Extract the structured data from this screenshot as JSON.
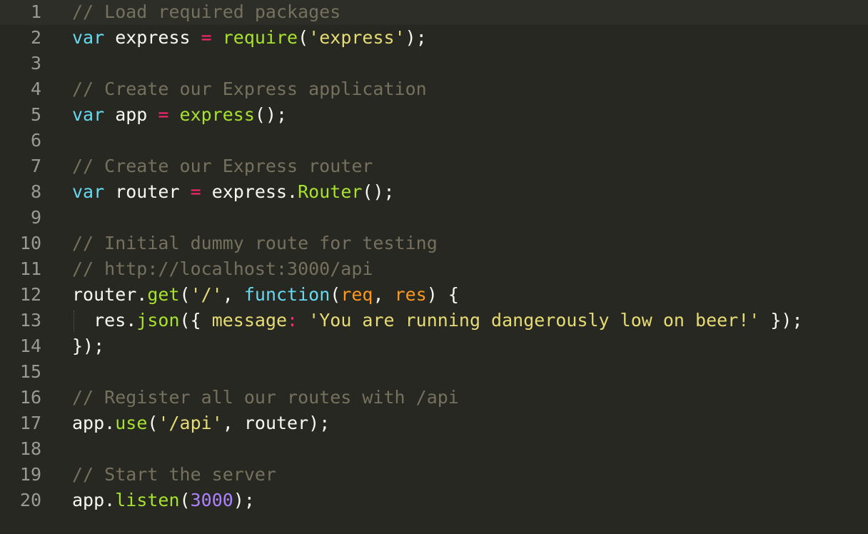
{
  "editor": {
    "theme_colors": {
      "background": "#272822",
      "comment": "#75715e",
      "keyword": "#66d9ef",
      "function": "#a6e22e",
      "string": "#e6db74",
      "operator": "#f92672",
      "parameter": "#fd971f",
      "number": "#ae81ff",
      "text": "#f8f8f2",
      "line_number": "#9a9a92"
    },
    "lines": [
      {
        "number": "1",
        "tokens": [
          {
            "t": "// Load required packages",
            "c": "comment"
          }
        ]
      },
      {
        "number": "2",
        "tokens": [
          {
            "t": "var",
            "c": "storage"
          },
          {
            "t": " express ",
            "c": "plain"
          },
          {
            "t": "=",
            "c": "op"
          },
          {
            "t": " ",
            "c": "plain"
          },
          {
            "t": "require",
            "c": "func"
          },
          {
            "t": "(",
            "c": "plain"
          },
          {
            "t": "'express'",
            "c": "string"
          },
          {
            "t": ");",
            "c": "plain"
          }
        ]
      },
      {
        "number": "3",
        "tokens": []
      },
      {
        "number": "4",
        "tokens": [
          {
            "t": "// Create our Express application",
            "c": "comment"
          }
        ]
      },
      {
        "number": "5",
        "tokens": [
          {
            "t": "var",
            "c": "storage"
          },
          {
            "t": " app ",
            "c": "plain"
          },
          {
            "t": "=",
            "c": "op"
          },
          {
            "t": " ",
            "c": "plain"
          },
          {
            "t": "express",
            "c": "func"
          },
          {
            "t": "();",
            "c": "plain"
          }
        ]
      },
      {
        "number": "6",
        "tokens": []
      },
      {
        "number": "7",
        "tokens": [
          {
            "t": "// Create our Express router",
            "c": "comment"
          }
        ]
      },
      {
        "number": "8",
        "tokens": [
          {
            "t": "var",
            "c": "storage"
          },
          {
            "t": " router ",
            "c": "plain"
          },
          {
            "t": "=",
            "c": "op"
          },
          {
            "t": " express.",
            "c": "plain"
          },
          {
            "t": "Router",
            "c": "func"
          },
          {
            "t": "();",
            "c": "plain"
          }
        ]
      },
      {
        "number": "9",
        "tokens": []
      },
      {
        "number": "10",
        "tokens": [
          {
            "t": "// Initial dummy route for testing",
            "c": "comment"
          }
        ]
      },
      {
        "number": "11",
        "tokens": [
          {
            "t": "// http://localhost:3000/api",
            "c": "comment"
          }
        ]
      },
      {
        "number": "12",
        "tokens": [
          {
            "t": "router.",
            "c": "plain"
          },
          {
            "t": "get",
            "c": "func"
          },
          {
            "t": "(",
            "c": "plain"
          },
          {
            "t": "'/'",
            "c": "string"
          },
          {
            "t": ", ",
            "c": "plain"
          },
          {
            "t": "function",
            "c": "storage"
          },
          {
            "t": "(",
            "c": "plain"
          },
          {
            "t": "req",
            "c": "param"
          },
          {
            "t": ", ",
            "c": "plain"
          },
          {
            "t": "res",
            "c": "param"
          },
          {
            "t": ") {",
            "c": "plain"
          }
        ]
      },
      {
        "number": "13",
        "tokens": [
          {
            "t": "  res.",
            "c": "plain"
          },
          {
            "t": "json",
            "c": "func"
          },
          {
            "t": "({ ",
            "c": "plain"
          },
          {
            "t": "message",
            "c": "string"
          },
          {
            "t": ":",
            "c": "op"
          },
          {
            "t": " ",
            "c": "plain"
          },
          {
            "t": "'You are running dangerously low on beer!'",
            "c": "string"
          },
          {
            "t": " });",
            "c": "plain"
          }
        ]
      },
      {
        "number": "14",
        "tokens": [
          {
            "t": "});",
            "c": "plain"
          }
        ]
      },
      {
        "number": "15",
        "tokens": []
      },
      {
        "number": "16",
        "tokens": [
          {
            "t": "// Register all our routes with /api",
            "c": "comment"
          }
        ]
      },
      {
        "number": "17",
        "tokens": [
          {
            "t": "app.",
            "c": "plain"
          },
          {
            "t": "use",
            "c": "func"
          },
          {
            "t": "(",
            "c": "plain"
          },
          {
            "t": "'/api'",
            "c": "string"
          },
          {
            "t": ", router);",
            "c": "plain"
          }
        ]
      },
      {
        "number": "18",
        "tokens": []
      },
      {
        "number": "19",
        "tokens": [
          {
            "t": "// Start the server",
            "c": "comment"
          }
        ]
      },
      {
        "number": "20",
        "tokens": [
          {
            "t": "app.",
            "c": "plain"
          },
          {
            "t": "listen",
            "c": "func"
          },
          {
            "t": "(",
            "c": "plain"
          },
          {
            "t": "3000",
            "c": "num"
          },
          {
            "t": ");",
            "c": "plain"
          }
        ]
      }
    ]
  }
}
